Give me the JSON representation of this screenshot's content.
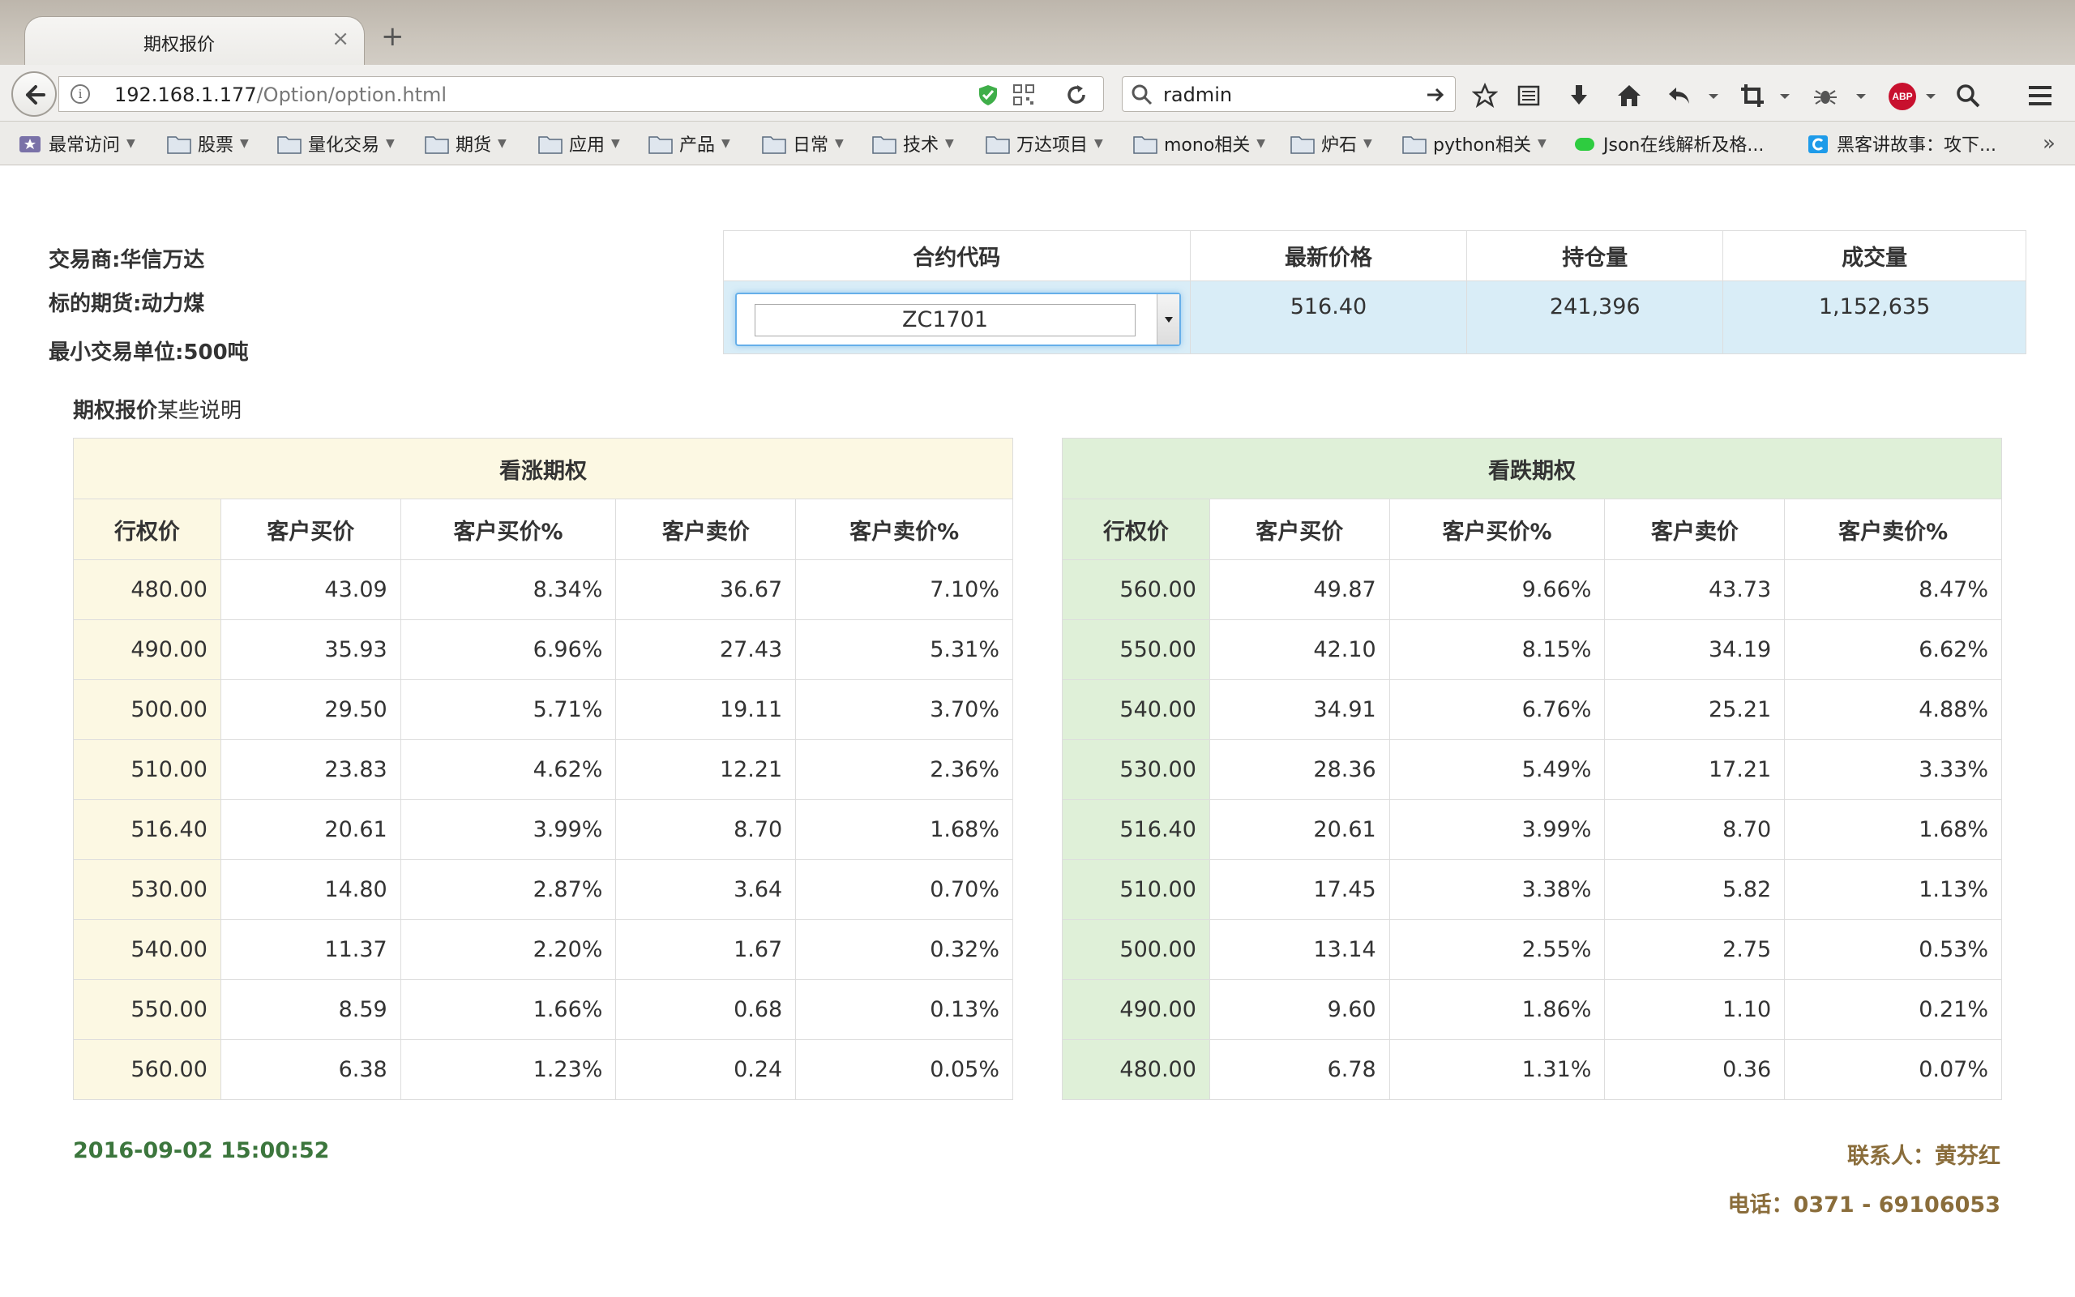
{
  "browser": {
    "tab_title": "期权报价",
    "tab_close": "×",
    "new_tab": "+",
    "url_host": "192.168.1.177",
    "url_path": "/Option/option.html",
    "search_value": "radmin",
    "abp_label": "ABP",
    "bookmarks": [
      {
        "label": "最常访问",
        "icon": "star-bookmark-icon"
      },
      {
        "label": "股票",
        "icon": "folder-icon"
      },
      {
        "label": "量化交易",
        "icon": "folder-icon"
      },
      {
        "label": "期货",
        "icon": "folder-icon"
      },
      {
        "label": "应用",
        "icon": "folder-icon"
      },
      {
        "label": "产品",
        "icon": "folder-icon"
      },
      {
        "label": "日常",
        "icon": "folder-icon"
      },
      {
        "label": "技术",
        "icon": "folder-icon"
      },
      {
        "label": "万达项目",
        "icon": "folder-icon"
      },
      {
        "label": "mono相关",
        "icon": "folder-icon"
      },
      {
        "label": "炉石",
        "icon": "folder-icon"
      },
      {
        "label": "python相关",
        "icon": "folder-icon"
      },
      {
        "label": "Json在线解析及格...",
        "icon": "json-icon"
      },
      {
        "label": "黑客讲故事：攻下...",
        "icon": "c-icon"
      }
    ],
    "bookmarks_more": "»"
  },
  "info": {
    "trader": "交易商:华信万达",
    "underlying": "标的期货:动力煤",
    "min_unit": "最小交易单位:500吨"
  },
  "quote": {
    "headers": [
      "合约代码",
      "最新价格",
      "持仓量",
      "成交量"
    ],
    "contract": "ZC1701",
    "last_price": "516.40",
    "open_interest": "241,396",
    "volume": "1,152,635"
  },
  "note": {
    "bold": "期权报价",
    "rest": "某些说明"
  },
  "call": {
    "title": "看涨期权",
    "headers": [
      "行权价",
      "客户买价",
      "客户买价%",
      "客户卖价",
      "客户卖价%"
    ],
    "rows": [
      [
        "480.00",
        "43.09",
        "8.34%",
        "36.67",
        "7.10%"
      ],
      [
        "490.00",
        "35.93",
        "6.96%",
        "27.43",
        "5.31%"
      ],
      [
        "500.00",
        "29.50",
        "5.71%",
        "19.11",
        "3.70%"
      ],
      [
        "510.00",
        "23.83",
        "4.62%",
        "12.21",
        "2.36%"
      ],
      [
        "516.40",
        "20.61",
        "3.99%",
        "8.70",
        "1.68%"
      ],
      [
        "530.00",
        "14.80",
        "2.87%",
        "3.64",
        "0.70%"
      ],
      [
        "540.00",
        "11.37",
        "2.20%",
        "1.67",
        "0.32%"
      ],
      [
        "550.00",
        "8.59",
        "1.66%",
        "0.68",
        "0.13%"
      ],
      [
        "560.00",
        "6.38",
        "1.23%",
        "0.24",
        "0.05%"
      ]
    ]
  },
  "put": {
    "title": "看跌期权",
    "headers": [
      "行权价",
      "客户买价",
      "客户买价%",
      "客户卖价",
      "客户卖价%"
    ],
    "rows": [
      [
        "560.00",
        "49.87",
        "9.66%",
        "43.73",
        "8.47%"
      ],
      [
        "550.00",
        "42.10",
        "8.15%",
        "34.19",
        "6.62%"
      ],
      [
        "540.00",
        "34.91",
        "6.76%",
        "25.21",
        "4.88%"
      ],
      [
        "530.00",
        "28.36",
        "5.49%",
        "17.21",
        "3.33%"
      ],
      [
        "516.40",
        "20.61",
        "3.99%",
        "8.70",
        "1.68%"
      ],
      [
        "510.00",
        "17.45",
        "3.38%",
        "5.82",
        "1.13%"
      ],
      [
        "500.00",
        "13.14",
        "2.55%",
        "2.75",
        "0.53%"
      ],
      [
        "490.00",
        "9.60",
        "1.86%",
        "1.10",
        "0.21%"
      ],
      [
        "480.00",
        "6.78",
        "1.31%",
        "0.36",
        "0.07%"
      ]
    ]
  },
  "footer": {
    "timestamp": "2016-09-02 15:00:52",
    "contact": "联系人：黄芬红",
    "phone": "电话：0371 - 69106053"
  },
  "colors": {
    "call_bg": "#fcf8e3",
    "put_bg": "#dff0d8",
    "quote_row_bg": "#d9edf7",
    "timestamp": "#3c763d",
    "contact": "#8a6d3b"
  }
}
